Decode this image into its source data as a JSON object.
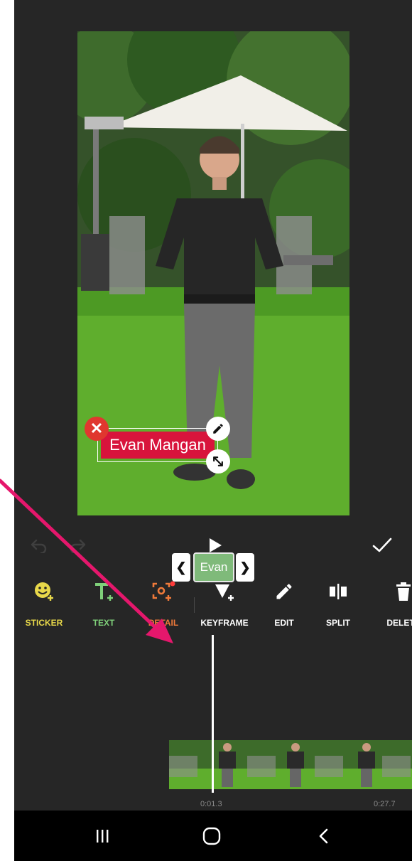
{
  "video": {
    "overlay_text": "Evan Mangan"
  },
  "toolbar": {
    "items": [
      {
        "label": "STICKER",
        "color": "#e8d84a",
        "icon": "sticker-icon"
      },
      {
        "label": "TEXT",
        "color": "#7fd07a",
        "icon": "text-add-icon"
      },
      {
        "label": "DETAIL",
        "color": "#f07a3a",
        "icon": "detail-icon"
      },
      {
        "label": "KEYFRAME",
        "color": "#ffffff",
        "icon": "keyframe-icon"
      },
      {
        "label": "EDIT",
        "color": "#ffffff",
        "icon": "pencil-icon"
      },
      {
        "label": "SPLIT",
        "color": "#ffffff",
        "icon": "split-icon"
      },
      {
        "label": "DELETE",
        "color": "#ffffff",
        "icon": "trash-icon"
      }
    ]
  },
  "timeline": {
    "clip_label": "Evan",
    "time_current": "0:01.3",
    "time_total": "0:27.7"
  },
  "annotation": {
    "arrow_color": "#e5176c"
  }
}
